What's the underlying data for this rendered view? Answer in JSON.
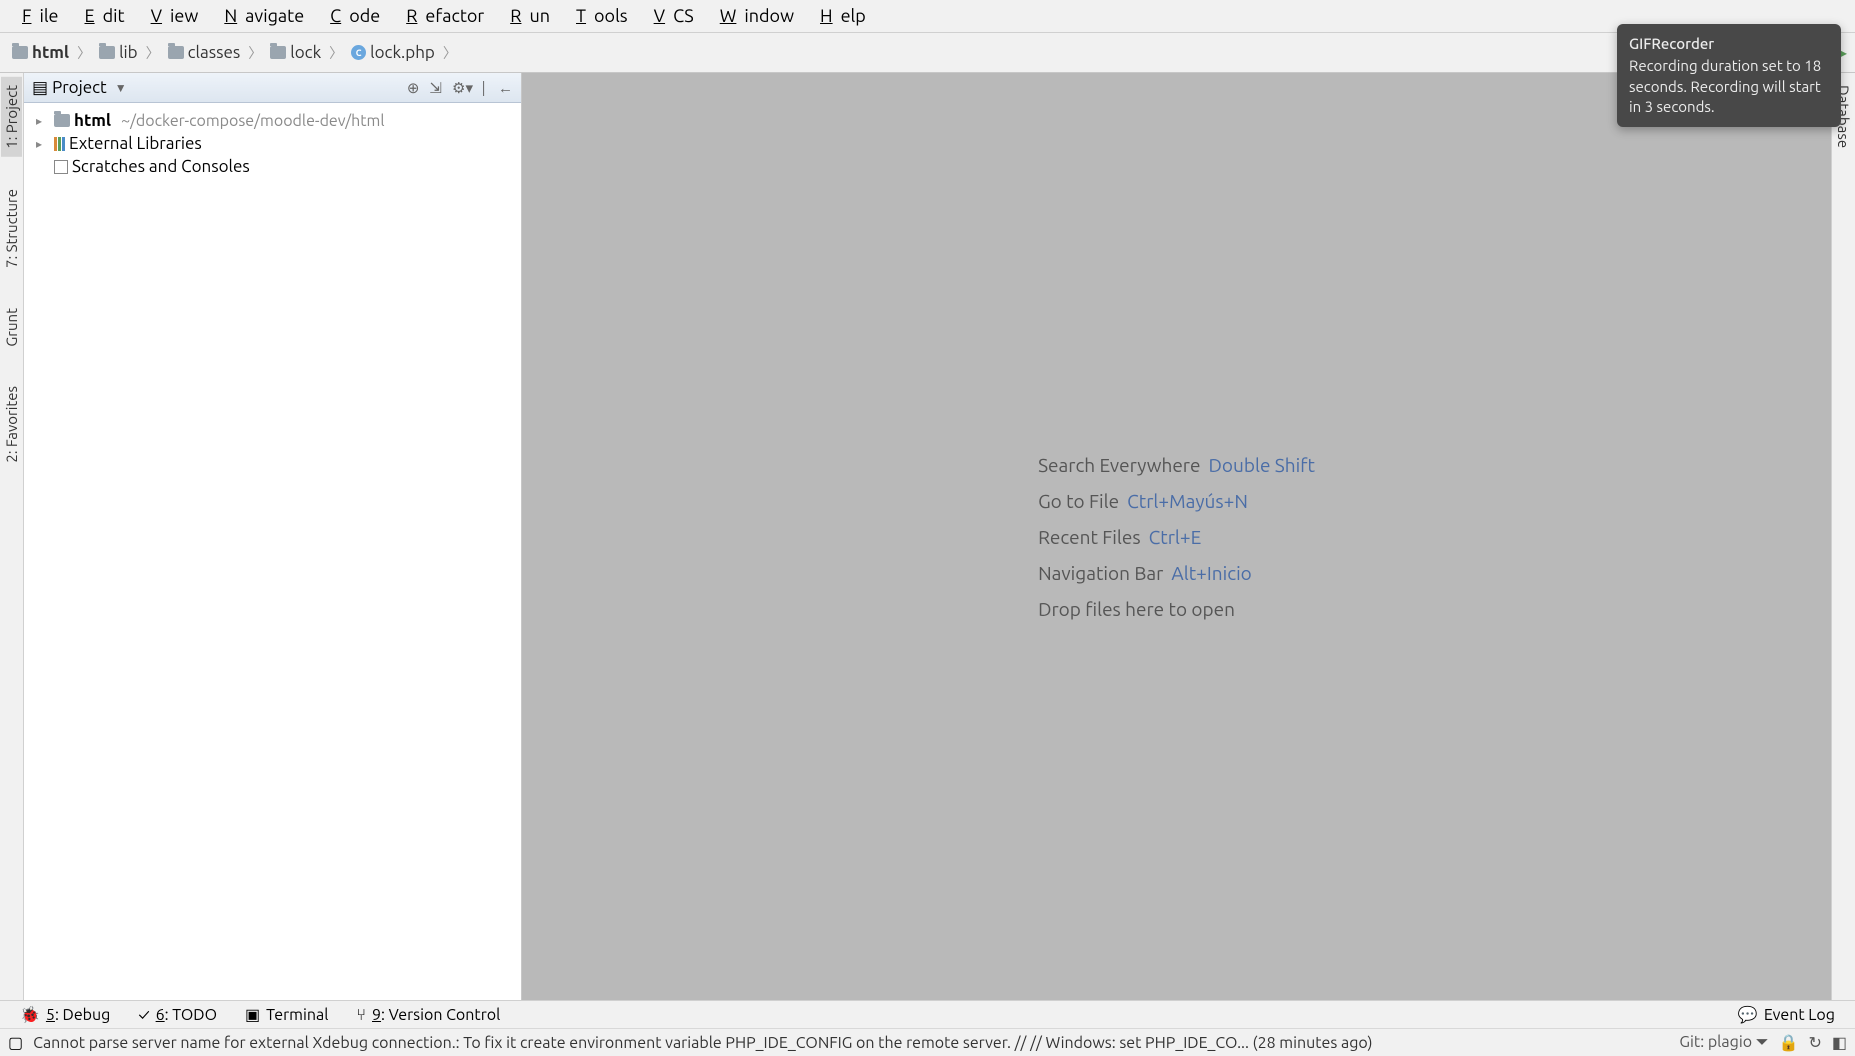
{
  "menu": [
    "File",
    "Edit",
    "View",
    "Navigate",
    "Code",
    "Refactor",
    "Run",
    "Tools",
    "VCS",
    "Window",
    "Help"
  ],
  "breadcrumbs": [
    {
      "label": "html",
      "icon": "folder",
      "bold": true
    },
    {
      "label": "lib",
      "icon": "folder"
    },
    {
      "label": "classes",
      "icon": "folder"
    },
    {
      "label": "lock",
      "icon": "folder"
    },
    {
      "label": "lock.php",
      "icon": "php"
    }
  ],
  "left_tools": [
    {
      "label": "1: Project",
      "active": true
    },
    {
      "label": "7: Structure",
      "active": false
    },
    {
      "label": "Grunt",
      "active": false
    },
    {
      "label": "2: Favorites",
      "active": false
    }
  ],
  "right_tools": [
    {
      "label": "Database"
    }
  ],
  "project_panel": {
    "title": "Project",
    "tree": [
      {
        "label": "html",
        "suffix": "~/docker-compose/moodle-dev/html",
        "icon": "folder",
        "arrow": true,
        "bold": true
      },
      {
        "label": "External Libraries",
        "icon": "lib",
        "arrow": true
      },
      {
        "label": "Scratches and Consoles",
        "icon": "scratch",
        "arrow": false
      }
    ]
  },
  "empty_editor": [
    {
      "text": "Search Everywhere",
      "shortcut": "Double Shift"
    },
    {
      "text": "Go to File",
      "shortcut": "Ctrl+Mayús+N"
    },
    {
      "text": "Recent Files",
      "shortcut": "Ctrl+E"
    },
    {
      "text": "Navigation Bar",
      "shortcut": "Alt+Inicio"
    },
    {
      "text": "Drop files here to open",
      "shortcut": ""
    }
  ],
  "bottom_tabs": [
    {
      "label": "5: Debug",
      "icon": "🐞",
      "underline": "5"
    },
    {
      "label": "6: TODO",
      "icon": "✓",
      "underline": "6"
    },
    {
      "label": "Terminal",
      "icon": "▣"
    },
    {
      "label": "9: Version Control",
      "icon": "⑂",
      "underline": "9"
    }
  ],
  "event_log_label": "Event Log",
  "status": {
    "message": "Cannot parse server name for external Xdebug connection.: To fix it create environment variable PHP_IDE_CONFIG on the remote server. // // Windows: set PHP_IDE_CO... (28 minutes ago)",
    "git_label": "Git: plagio"
  },
  "notification": {
    "title": "GIFRecorder",
    "body": "Recording duration set to 18 seconds. Recording will start in 3 seconds."
  }
}
